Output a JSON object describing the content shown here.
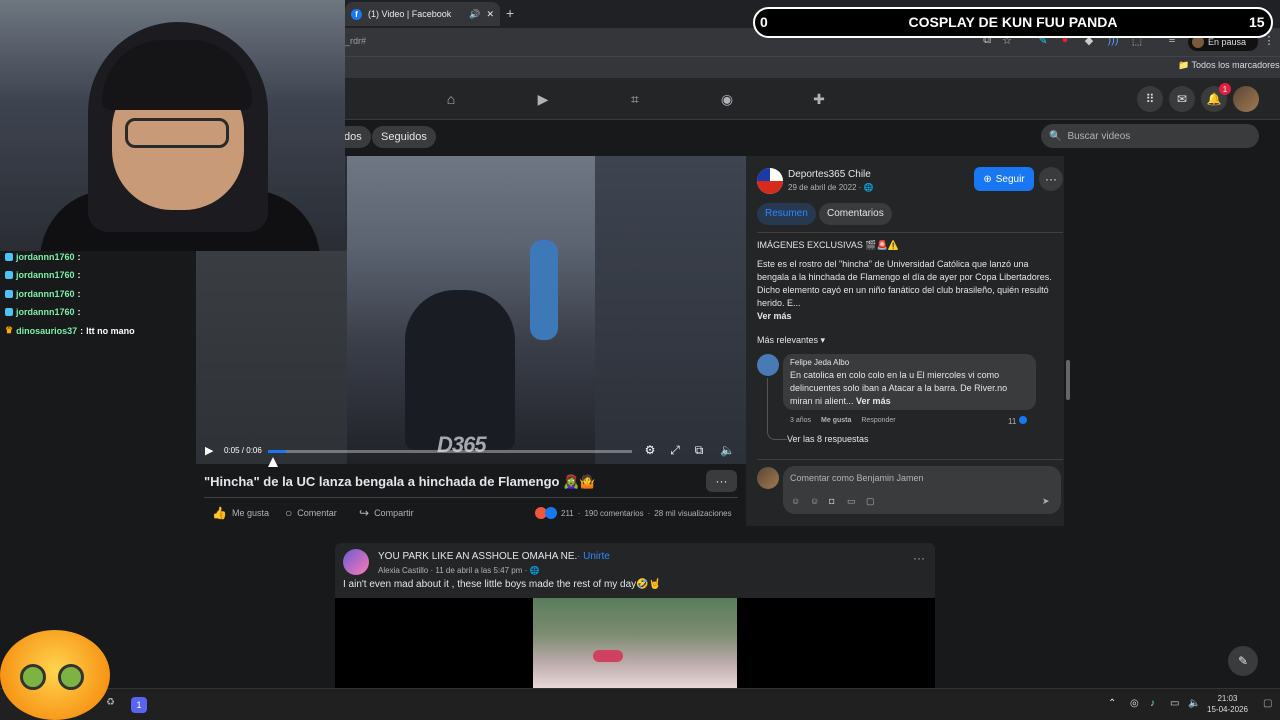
{
  "browser": {
    "tab_title": "(1) Video | Facebook",
    "url_fragment": "_rdr#",
    "paused_label": "En pausa",
    "all_bookmarks": "Todos los marcadores"
  },
  "fb_header": {
    "notification_count": "1"
  },
  "subnav": {
    "left_pill": "dos",
    "following_pill": "Seguidos",
    "search_placeholder": "Buscar videos"
  },
  "video": {
    "time": "0:05 / 0:06",
    "progress_fraction": 0.05,
    "watermark": "D365",
    "title": "\"Hincha\" de la UC lanza bengala a hinchada de Flamengo 🧟‍♀️🤷",
    "actions": {
      "like": "Me gusta",
      "comment": "Comentar",
      "share": "Compartir"
    },
    "reactions_count": "211",
    "comments_count": "190 comentarios",
    "views": "28 mil visualizaciones"
  },
  "side": {
    "page_name": "Deportes365 Chile",
    "page_date": "29 de abril de 2022 · 🌐",
    "follow_label": "Seguir",
    "tab_summary": "Resumen",
    "tab_comments": "Comentarios",
    "desc_headline": "IMÁGENES EXCLUSIVAS 🎬🚨⚠️",
    "desc_body": "Este es el rostro del \"hincha\" de Universidad Católica que lanzó una bengala a la hinchada de Flamengo el día de ayer por Copa Libertadores. Dicho elemento cayó en un niño fanático del club brasileño, quién resultó herido. E...",
    "see_more": "Ver más",
    "most_relevant": "Más relevantes",
    "comment": {
      "author": "Felipe Jeda Albo",
      "text": "En catolica en colo colo en la u El miercoles vi como delincuentes solo iban a Atacar a la barra. De River.no miran ni alient...",
      "see_more": "Ver más",
      "age": "3 años",
      "like": "Me gusta",
      "reply": "Responder",
      "likes": "11"
    },
    "view_replies": "Ver las 8 respuestas",
    "comment_placeholder": "Comentar como Benjamin Jamen"
  },
  "post2": {
    "group": "YOU PARK LIKE AN ASSHOLE OMAHA NE.",
    "join": "Unirte",
    "meta": "Alexia Castillo · 11 de abril a las 5:47 pm · 🌐",
    "text": "I ain't even mad about it , these little boys made  the rest of my day🤣🤘"
  },
  "taskbar": {
    "time": "21:03",
    "date": "15-04-2026",
    "discord_badge": "1"
  },
  "overlay": {
    "chat": [
      {
        "user": "jordannn1760",
        "msg": ""
      },
      {
        "user": "jordannn1760",
        "msg": ""
      },
      {
        "user": "jordannn1760",
        "msg": ""
      },
      {
        "user": "jordannn1760",
        "msg": ""
      },
      {
        "user": "dinosaurios37",
        "msg": "ltt no mano"
      }
    ],
    "score_left": "0",
    "score_title": "COSPLAY DE KUN FUU PANDA",
    "score_right": "15"
  },
  "colors": {
    "fb_blue": "#1877f2",
    "fb_bg": "#18191a",
    "fb_card": "#242526"
  }
}
